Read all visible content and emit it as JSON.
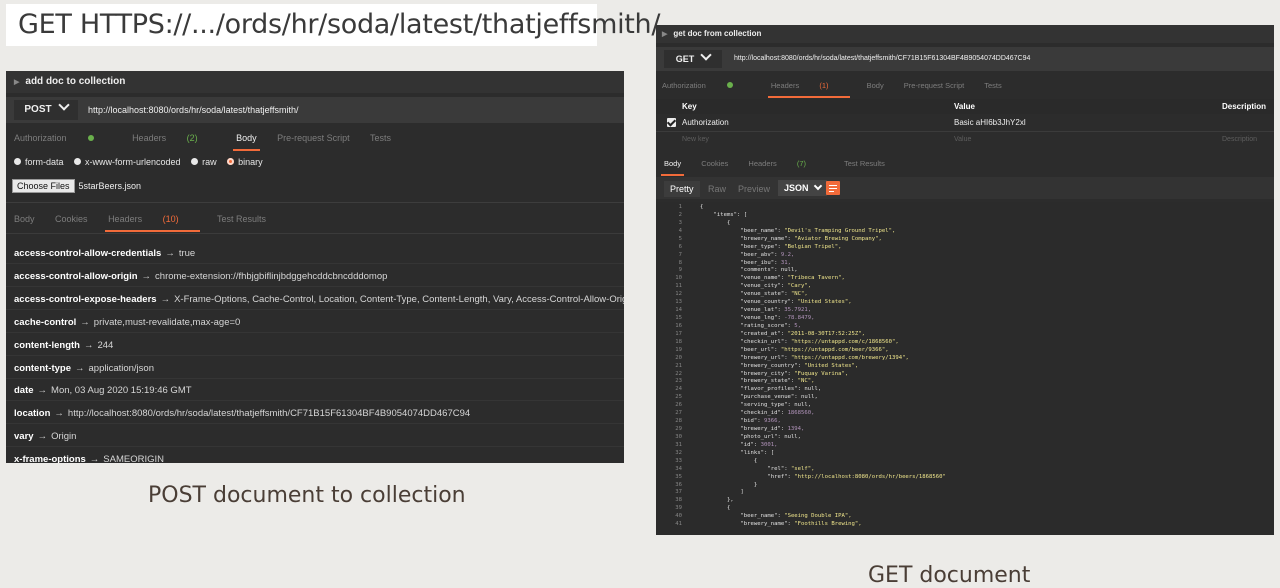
{
  "slide": {
    "url_title": "GET HTTPS://.../ords/hr/soda/latest/thatjeffsmith/",
    "left_caption": "POST document to collection",
    "right_caption": "GET document"
  },
  "post_panel": {
    "title": "add doc to collection",
    "method": "POST",
    "url": "http://localhost:8080/ords/hr/soda/latest/thatjeffsmith/",
    "request_tabs": [
      "Authorization",
      "Headers",
      "(2)",
      "Body",
      "Pre-request Script",
      "Tests"
    ],
    "body_options": [
      "form-data",
      "x-www-form-urlencoded",
      "raw",
      "binary"
    ],
    "selected_body_option": "binary",
    "choose_files_label": "Choose Files",
    "file_name": "5starBeers.json",
    "response_tabs": [
      "Body",
      "Cookies",
      "Headers",
      "(10)",
      "Test Results"
    ],
    "response_headers": [
      {
        "key": "access-control-allow-credentials",
        "value": "true"
      },
      {
        "key": "access-control-allow-origin",
        "value": "chrome-extension://fhbjgbiflinjbdggehcddcbncdddomop"
      },
      {
        "key": "access-control-expose-headers",
        "value": "X-Frame-Options, Cache-Control, Location, Content-Type, Content-Length, Vary, Access-Control-Allow-Origin, Access-Control-Allow-Credentials"
      },
      {
        "key": "cache-control",
        "value": "private,must-revalidate,max-age=0"
      },
      {
        "key": "content-length",
        "value": "244"
      },
      {
        "key": "content-type",
        "value": "application/json"
      },
      {
        "key": "date",
        "value": "Mon, 03 Aug 2020 15:19:46 GMT"
      },
      {
        "key": "location",
        "value": "http://localhost:8080/ords/hr/soda/latest/thatjeffsmith/CF71B15F61304BF4B9054074DD467C94"
      },
      {
        "key": "vary",
        "value": "Origin"
      },
      {
        "key": "x-frame-options",
        "value": "SAMEORIGIN"
      }
    ],
    "arrow": "→"
  },
  "get_panel": {
    "title": "get doc from collection",
    "method": "GET",
    "url": "http://localhost:8080/ords/hr/soda/latest/thatjeffsmith/CF71B15F61304BF4B9054074DD467C94",
    "request_tabs": [
      "Authorization",
      "Headers",
      "(1)",
      "Body",
      "Pre-request Script",
      "Tests"
    ],
    "table_headers": [
      "Key",
      "Value",
      "Description"
    ],
    "table_row": {
      "key": "Authorization",
      "value": "Basic aHI6b3JhY2xl"
    },
    "new_row": {
      "key": "New key",
      "value": "Value",
      "description": "Description"
    },
    "response_tabs": [
      "Body",
      "Cookies",
      "Headers",
      "(7)",
      "Test Results"
    ],
    "format_buttons": [
      "Pretty",
      "Raw",
      "Preview"
    ],
    "format_select": "JSON",
    "code_lines": [
      "{",
      "    \"items\": [",
      "        {",
      "            \"beer_name\": \"Devil's Tramping Ground Tripel\",",
      "            \"brewery_name\": \"Aviator Brewing Company\",",
      "            \"beer_type\": \"Belgian Tripel\",",
      "            \"beer_abv\": 9.2,",
      "            \"beer_ibu\": 31,",
      "            \"comments\": null,",
      "            \"venue_name\": \"Tribeca Tavern\",",
      "            \"venue_city\": \"Cary\",",
      "            \"venue_state\": \"NC\",",
      "            \"venue_country\": \"United States\",",
      "            \"venue_lat\": 35.7921,",
      "            \"venue_lng\": -78.8479,",
      "            \"rating_score\": 5,",
      "            \"created_at\": \"2011-08-30T17:52:25Z\",",
      "            \"checkin_url\": \"https://untappd.com/c/1868560\",",
      "            \"beer_url\": \"https://untappd.com/beer/9366\",",
      "            \"brewery_url\": \"https://untappd.com/brewery/1394\",",
      "            \"brewery_country\": \"United States\",",
      "            \"brewery_city\": \"Fuquay Varina\",",
      "            \"brewery_state\": \"NC\",",
      "            \"flavor_profiles\": null,",
      "            \"purchase_venue\": null,",
      "            \"serving_type\": null,",
      "            \"checkin_id\": 1868560,",
      "            \"bid\": 9366,",
      "            \"brewery_id\": 1394,",
      "            \"photo_url\": null,",
      "            \"id\": 3001,",
      "            \"links\": [",
      "                {",
      "                    \"rel\": \"self\",",
      "                    \"href\": \"http://localhost:8080/ords/hr/beers/1868560\"",
      "                }",
      "            ]",
      "        },",
      "        {",
      "            \"beer_name\": \"Seeing Double IPA\",",
      "            \"brewery_name\": \"Foothills Brewing\","
    ]
  }
}
